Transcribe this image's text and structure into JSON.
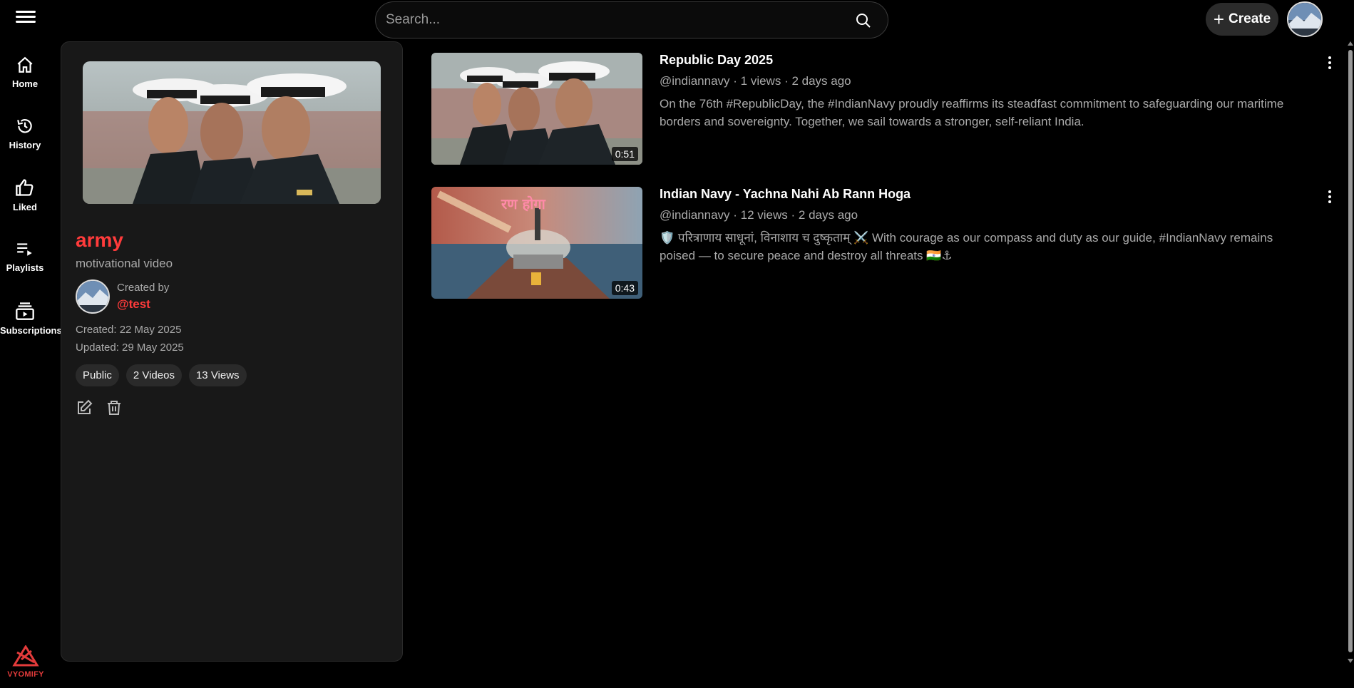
{
  "search": {
    "placeholder": "Search..."
  },
  "header": {
    "create_label": "Create"
  },
  "sidebar": {
    "items": [
      {
        "label": "Home",
        "icon": "home-icon"
      },
      {
        "label": "History",
        "icon": "history-icon"
      },
      {
        "label": "Liked",
        "icon": "thumbs-up-icon"
      },
      {
        "label": "Playlists",
        "icon": "playlist-icon"
      },
      {
        "label": "Subscriptions",
        "icon": "subscriptions-icon"
      }
    ],
    "brand": "VYOMIFY"
  },
  "playlist": {
    "title": "army",
    "description": "motivational video",
    "created_by_label": "Created by",
    "creator": "@test",
    "created": "Created: 22 May 2025",
    "updated": "Updated: 29 May 2025",
    "chips": [
      "Public",
      "2 Videos",
      "13 Views"
    ]
  },
  "videos": [
    {
      "title": "Republic Day 2025",
      "meta": "@indiannavy · 1 views · 2 days ago",
      "description": "On the 76th #RepublicDay, the #IndianNavy proudly reaffirms its steadfast commitment to safeguarding our maritime borders and sovereignty. Together, we sail towards a stronger, self-reliant India.",
      "duration": "0:51"
    },
    {
      "title": "Indian Navy - Yachna Nahi Ab Rann Hoga",
      "meta": "@indiannavy · 12 views · 2 days ago",
      "description": "🛡️ परित्राणाय साधूनां, विनाशाय च दुष्कृताम् ⚔️ With courage as our compass and duty as our guide, #IndianNavy remains poised — to secure peace and destroy all threats 🇮🇳⚓",
      "duration": "0:43",
      "overlay_text": "रण होगा"
    }
  ],
  "colors": {
    "accent": "#ff3b3b",
    "panel": "#181818",
    "chip": "#2a2a2a"
  }
}
